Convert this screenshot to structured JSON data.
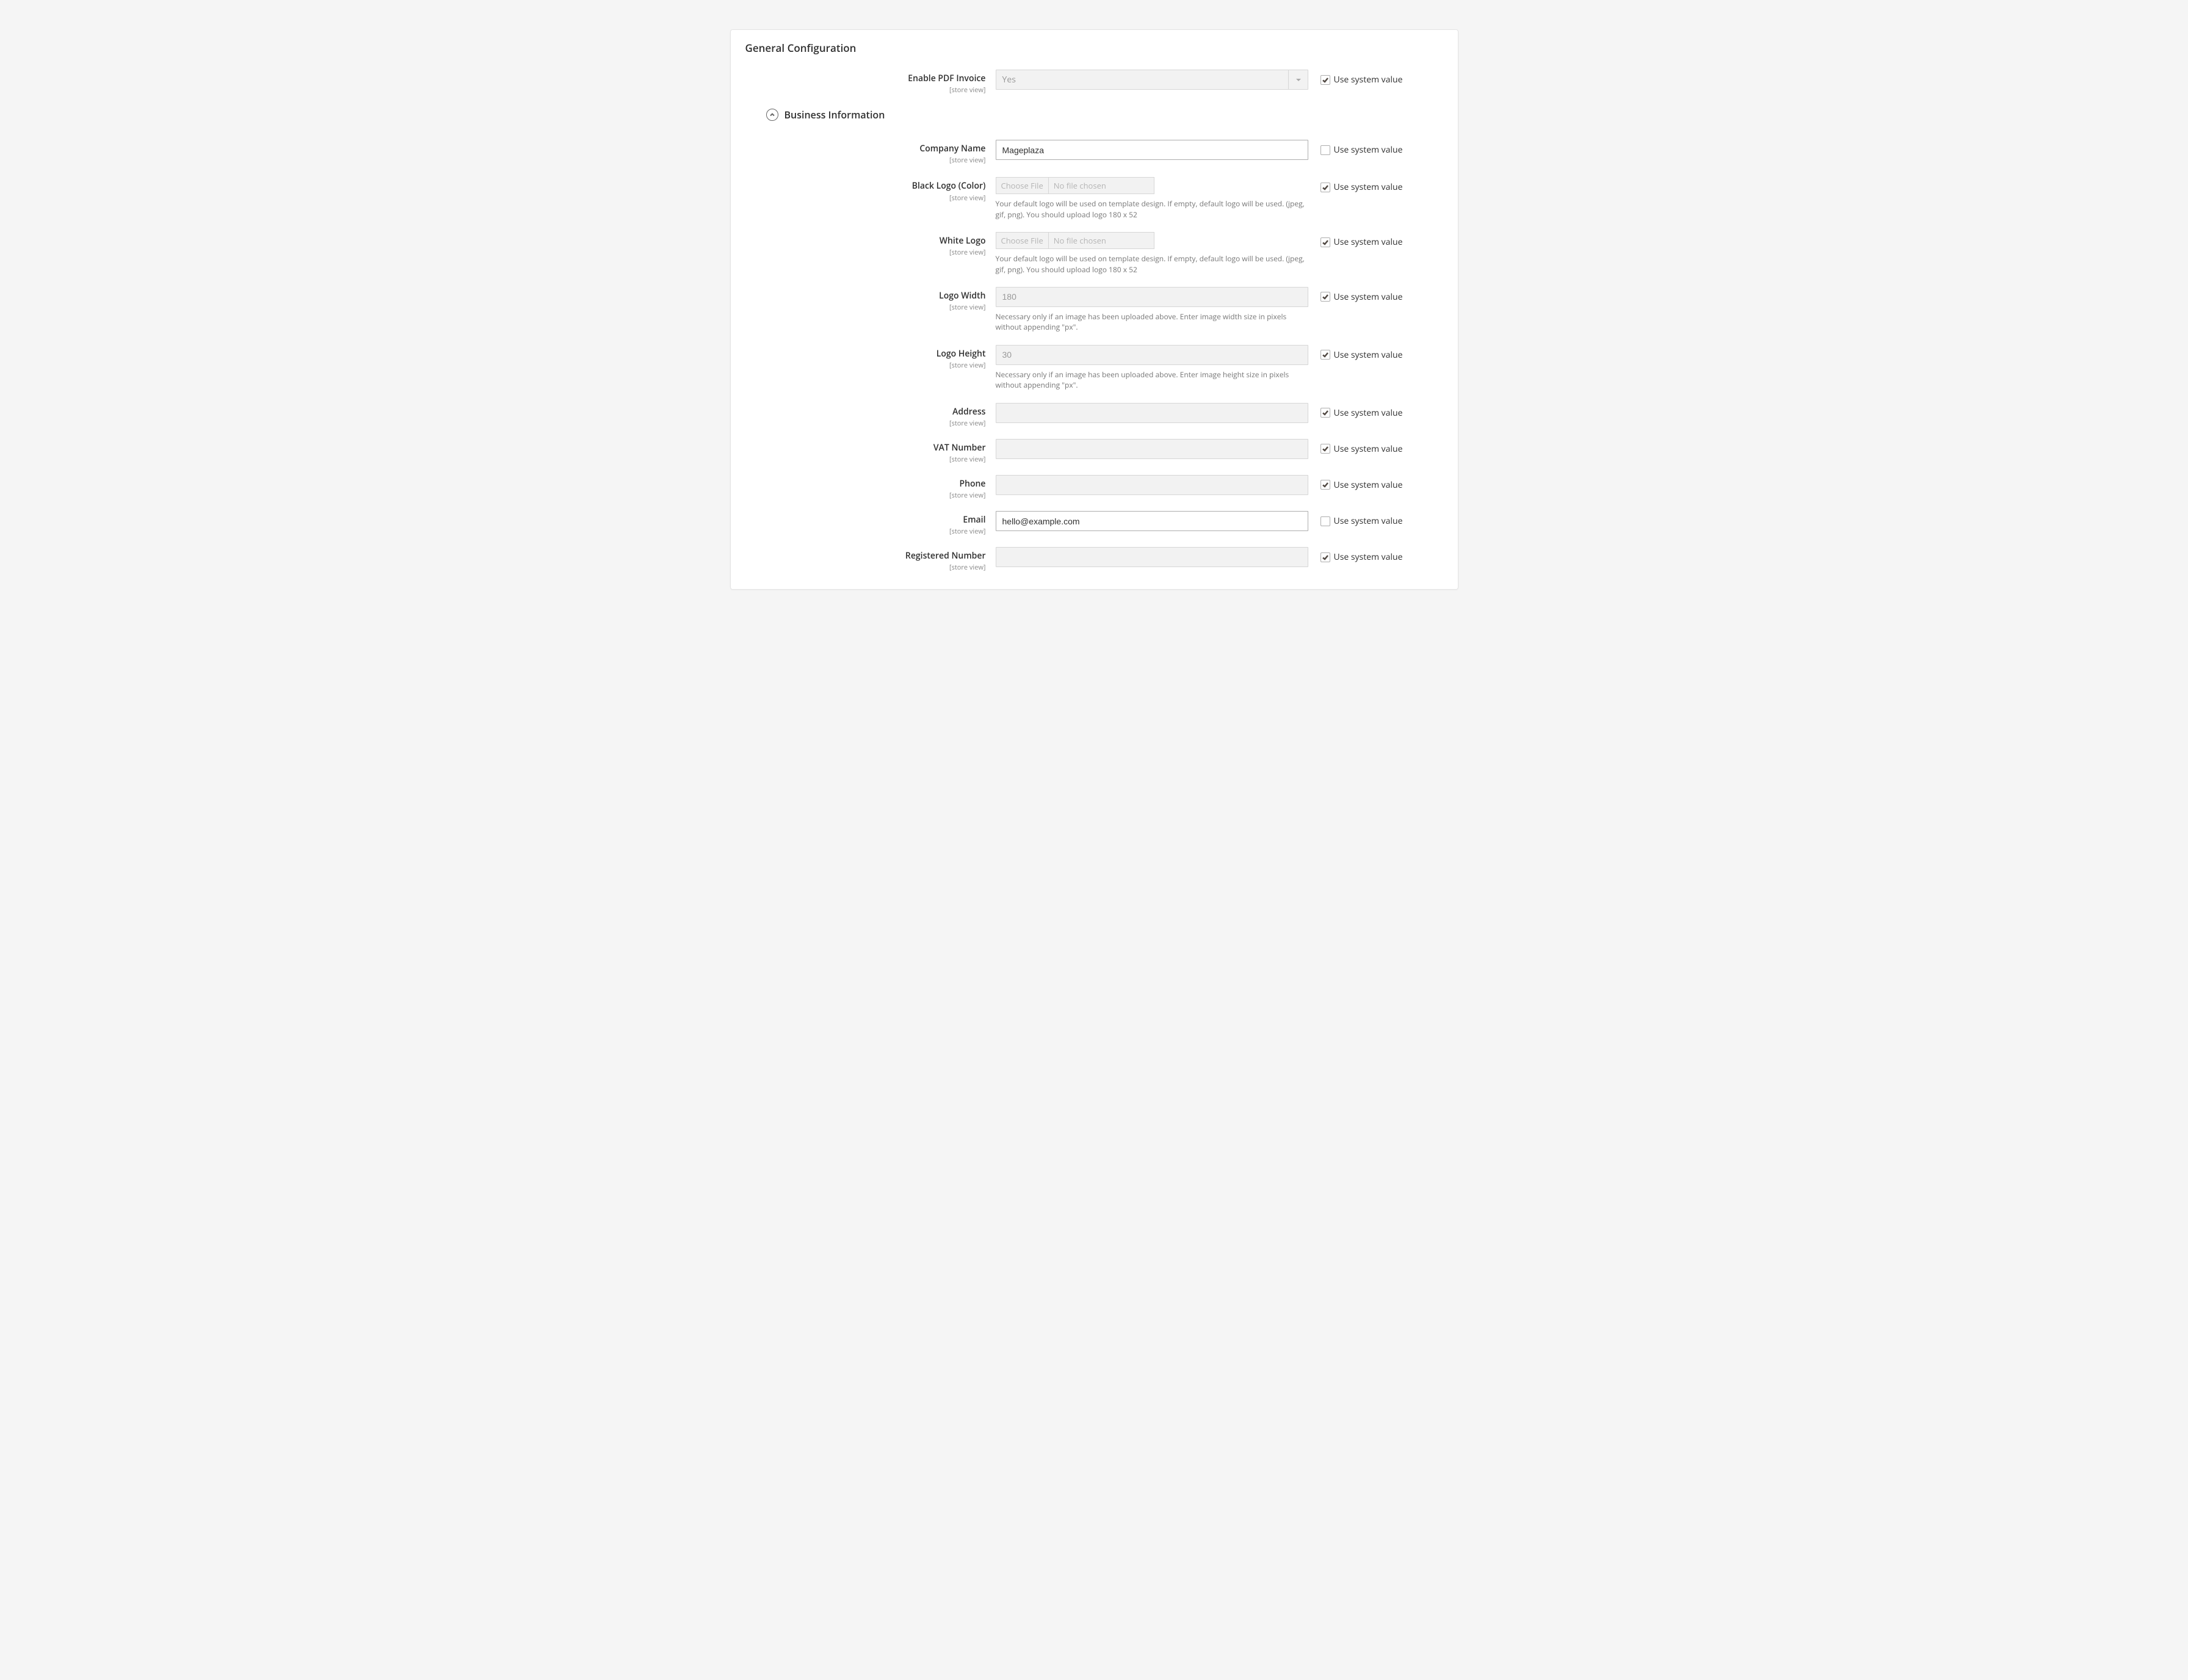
{
  "panel": {
    "title": "General Configuration"
  },
  "use_system_value_label": "Use system value",
  "scope_label": "[store view]",
  "section": {
    "business_information_title": "Business Information"
  },
  "file": {
    "choose_label": "Choose File",
    "no_file_label": "No file chosen"
  },
  "fields": {
    "enable_pdf_invoice": {
      "label": "Enable PDF Invoice",
      "value": "Yes",
      "use_system": true
    },
    "company_name": {
      "label": "Company Name",
      "value": "Mageplaza",
      "use_system": false
    },
    "black_logo": {
      "label": "Black Logo (Color)",
      "use_system": true,
      "note": "Your default logo will be used on template design. If empty, default logo will be used. (jpeg, gif, png). You should upload logo 180 x 52"
    },
    "white_logo": {
      "label": "White Logo",
      "use_system": true,
      "note": "Your default logo will be used on template design. If empty, default logo will be used. (jpeg, gif, png). You should upload logo 180 x 52"
    },
    "logo_width": {
      "label": "Logo Width",
      "value": "180",
      "use_system": true,
      "note": "Necessary only if an image has been uploaded above. Enter image width size in pixels without appending \"px\"."
    },
    "logo_height": {
      "label": "Logo Height",
      "value": "30",
      "use_system": true,
      "note": "Necessary only if an image has been uploaded above. Enter image height size in pixels without appending \"px\"."
    },
    "address": {
      "label": "Address",
      "value": "",
      "use_system": true
    },
    "vat_number": {
      "label": "VAT Number",
      "value": "",
      "use_system": true
    },
    "phone": {
      "label": "Phone",
      "value": "",
      "use_system": true
    },
    "email": {
      "label": "Email",
      "value": "hello@example.com",
      "use_system": false
    },
    "registered_number": {
      "label": "Registered Number",
      "value": "",
      "use_system": true
    }
  }
}
